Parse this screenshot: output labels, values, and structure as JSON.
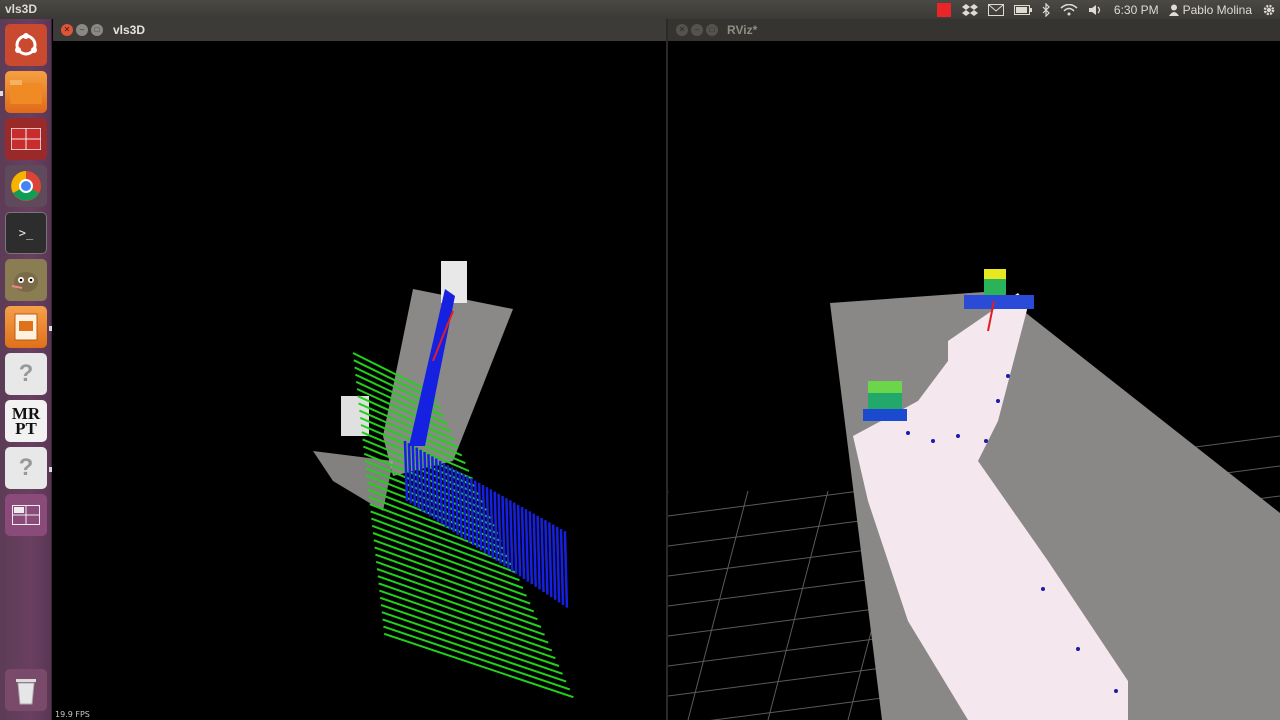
{
  "panel": {
    "app_title": "vls3D",
    "clock": "6:30 PM",
    "user": "Pablo Molina",
    "indicators": [
      "record-indicator",
      "dropbox-icon",
      "mail-icon",
      "battery-icon",
      "bluetooth-icon",
      "wifi-icon",
      "volume-icon"
    ]
  },
  "launcher": {
    "items": [
      {
        "name": "ubuntu-dash-icon"
      },
      {
        "name": "files-icon"
      },
      {
        "name": "workspace-app-icon"
      },
      {
        "name": "chrome-icon"
      },
      {
        "name": "terminal-icon"
      },
      {
        "name": "gimp-icon"
      },
      {
        "name": "impress-icon"
      },
      {
        "name": "unknown-app-icon"
      },
      {
        "name": "mrpt-icon",
        "label": "MR\nPT"
      },
      {
        "name": "unknown-app-icon"
      },
      {
        "name": "workspace-switcher-icon"
      },
      {
        "name": "trash-icon"
      }
    ]
  },
  "left_window": {
    "title": "vls3D",
    "fps": "19.9 FPS"
  },
  "right_window": {
    "title": "RViz*"
  },
  "colors": {
    "launcher": "#6a3f61",
    "close": "#e0553a",
    "green_beam": "#22d11a",
    "blue_wall": "#1620e0",
    "map_gray": "#8a8886",
    "free_space": "#f4e8ee"
  }
}
